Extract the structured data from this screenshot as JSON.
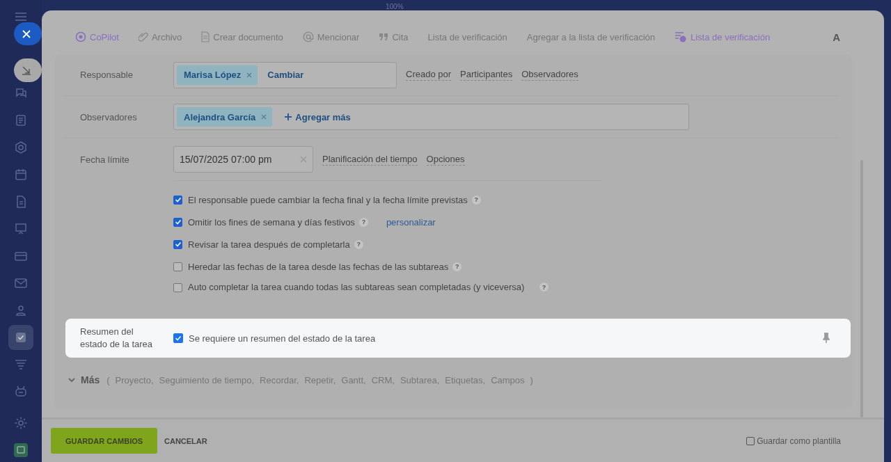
{
  "background": {
    "zoom_label": "100%"
  },
  "sidebar": {
    "items": [
      {
        "kind": "chat",
        "selected": false
      },
      {
        "kind": "doc",
        "selected": false
      },
      {
        "kind": "hexagon",
        "selected": false
      },
      {
        "kind": "calendar",
        "selected": false
      },
      {
        "kind": "file",
        "selected": false
      },
      {
        "kind": "board",
        "selected": false
      },
      {
        "kind": "card",
        "selected": false
      },
      {
        "kind": "mail",
        "selected": false
      },
      {
        "kind": "group",
        "selected": false
      },
      {
        "kind": "check",
        "selected": true
      },
      {
        "kind": "funnel",
        "selected": false
      },
      {
        "kind": "robot",
        "selected": false
      },
      {
        "kind": "gear",
        "selected": false
      },
      {
        "kind": "app",
        "selected": false
      }
    ]
  },
  "toolbar": {
    "items": [
      {
        "kind": "copilot",
        "label": "CoPilot"
      },
      {
        "kind": "attach",
        "label": "Archivo"
      },
      {
        "kind": "document",
        "label": "Crear documento"
      },
      {
        "kind": "mention",
        "label": "Mencionar"
      },
      {
        "kind": "quote",
        "label": "Cita"
      },
      {
        "kind": "text",
        "label": "Lista de verificación"
      },
      {
        "kind": "text",
        "label": "Agregar a la lista de verificación"
      },
      {
        "kind": "checklist",
        "label": "Lista de verificación"
      }
    ],
    "format_label": "A"
  },
  "responsible": {
    "label": "Responsable",
    "tags": [
      {
        "name": "Marisa López"
      }
    ],
    "action": "Cambiar",
    "links": [
      "Creado por",
      "Participantes",
      "Observadores"
    ]
  },
  "observers": {
    "label": "Observadores",
    "tags": [
      {
        "name": "Alejandra García"
      }
    ],
    "action": "Agregar más"
  },
  "deadline": {
    "label": "Fecha límite",
    "value": "15/07/2025 07:00 pm",
    "links": [
      "Planificación del tiempo",
      "Opciones"
    ]
  },
  "options": [
    {
      "label": "El responsable puede cambiar la fecha final y la fecha límite previstas",
      "checked": true,
      "help": "?"
    },
    {
      "label": "Omitir los fines de semana y días festivos",
      "checked": true,
      "help": "?",
      "link": "personalizar"
    },
    {
      "label": "Revisar la tarea después de completarla",
      "checked": true,
      "help": "?"
    },
    {
      "label": "Heredar las fechas de la tarea desde las fechas de las subtareas",
      "checked": false,
      "help": "?"
    },
    {
      "label": "Auto completar la tarea cuando todas las subtareas sean completadas (y viceversa)",
      "checked": false,
      "help": "?"
    }
  ],
  "summary": {
    "label": "Resumen del estado de la tarea",
    "option": "Se requiere un resumen del estado de la tarea",
    "checked": true
  },
  "more": {
    "label": "Más",
    "open": "(",
    "items": [
      "Proyecto,",
      "Seguimiento de tiempo,",
      "Recordar,",
      "Repetir,",
      "Gantt,",
      "CRM,",
      "Subtarea,",
      "Etiquetas,",
      "Campos"
    ],
    "close": ")"
  },
  "footer": {
    "save": "GUARDAR CAMBIOS",
    "cancel": "CANCELAR",
    "template": {
      "label": "Guardar como plantilla",
      "checked": false
    }
  }
}
